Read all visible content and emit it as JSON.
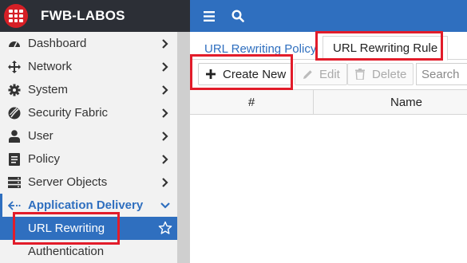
{
  "app": {
    "title": "FWB-LABOS",
    "brand_color": "#2f6fbf",
    "logo_color": "#d61f26"
  },
  "topbar": {
    "icons": [
      "hamburger-menu-icon",
      "search-icon"
    ]
  },
  "sidebar": {
    "items": [
      {
        "label": "Dashboard",
        "icon": "dashboard-icon"
      },
      {
        "label": "Network",
        "icon": "network-icon"
      },
      {
        "label": "System",
        "icon": "gear-icon"
      },
      {
        "label": "Security Fabric",
        "icon": "security-fabric-icon"
      },
      {
        "label": "User",
        "icon": "user-icon"
      },
      {
        "label": "Policy",
        "icon": "policy-icon"
      },
      {
        "label": "Server Objects",
        "icon": "server-icon"
      },
      {
        "label": "Application Delivery",
        "icon": "app-delivery-icon",
        "expanded": true
      },
      {
        "label": "URL Rewriting",
        "active": true
      },
      {
        "label": "Authentication"
      }
    ]
  },
  "tabs": [
    {
      "label": "URL Rewriting Policy",
      "active": false
    },
    {
      "label": "URL Rewriting Rule",
      "active": true
    }
  ],
  "toolbar": {
    "create_label": "Create New",
    "edit_label": "Edit",
    "delete_label": "Delete",
    "search_placeholder": "Search"
  },
  "table": {
    "columns": [
      "#",
      "Name"
    ]
  },
  "highlight_color": "#e21c2a"
}
